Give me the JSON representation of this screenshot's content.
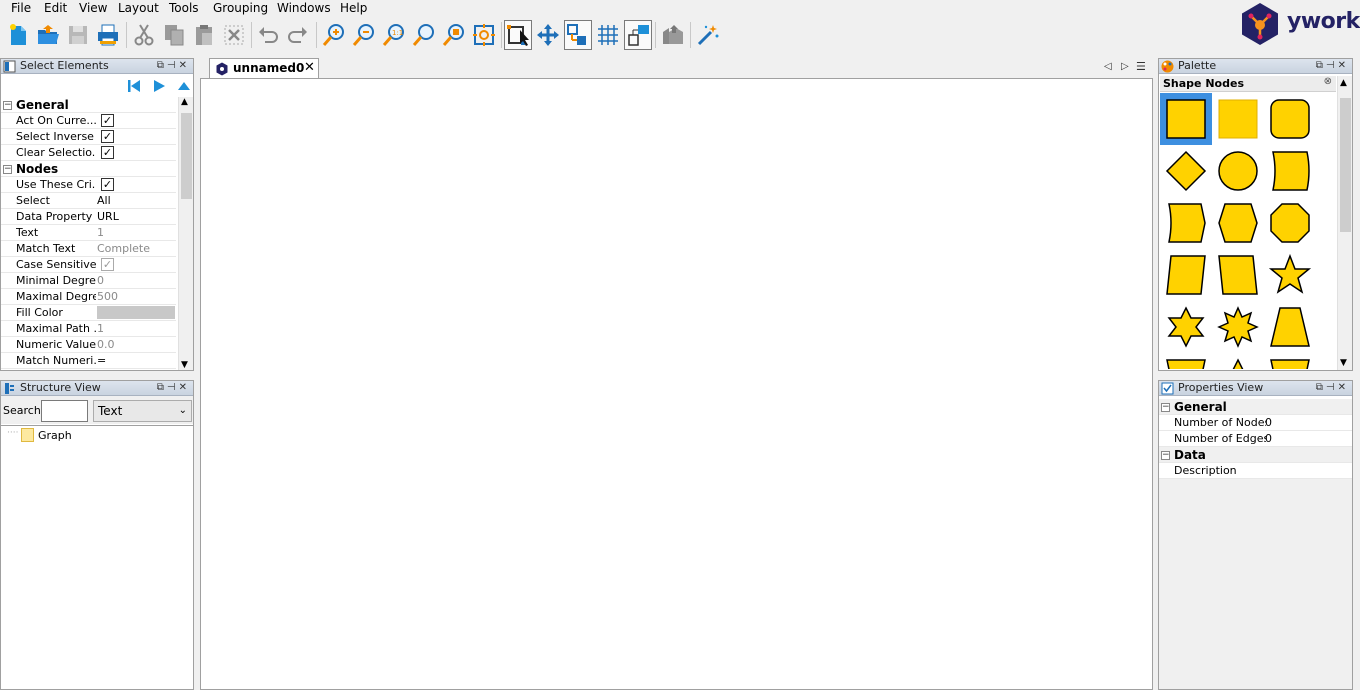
{
  "menu": [
    "File",
    "Edit",
    "View",
    "Layout",
    "Tools",
    "Grouping",
    "Windows",
    "Help"
  ],
  "logo": {
    "text": "yworks"
  },
  "toolbar": {
    "buttons": [
      "new-document",
      "open",
      "save",
      "print",
      "cut",
      "copy",
      "paste",
      "delete",
      "undo",
      "redo",
      "zoom-in",
      "zoom-out",
      "zoom-original",
      "zoom-fit",
      "zoom-area",
      "fit-content",
      "edit-mode",
      "move-mode",
      "port-mode",
      "grid",
      "snapping",
      "overview",
      "auto-layout"
    ]
  },
  "select_elements": {
    "title": "Select Elements",
    "general_section": "General",
    "nodes_section": "Nodes",
    "rows": [
      {
        "label": "Act On Curre...",
        "type": "checkbox",
        "checked": true
      },
      {
        "label": "Select Inverse",
        "type": "checkbox",
        "checked": true
      },
      {
        "label": "Clear Selectio...",
        "type": "checkbox",
        "checked": true
      },
      {
        "label": "Use These Cri...",
        "type": "checkbox",
        "checked": true
      },
      {
        "label": "Select",
        "value": "All"
      },
      {
        "label": "Data Property",
        "value": "URL"
      },
      {
        "label": "Text",
        "value": "1",
        "dim": true
      },
      {
        "label": "Match Text",
        "value": "Complete",
        "dim": true
      },
      {
        "label": "Case Sensitive",
        "type": "checkbox",
        "checked": true,
        "dim": true
      },
      {
        "label": "Minimal Degree",
        "value": "0",
        "dim": true
      },
      {
        "label": "Maximal Degree",
        "value": "500",
        "dim": true
      },
      {
        "label": "Fill Color",
        "value": "",
        "color": "#c8c8c8"
      },
      {
        "label": "Maximal Path ...",
        "value": "1",
        "dim": true
      },
      {
        "label": "Numeric Value",
        "value": "0.0",
        "dim": true
      },
      {
        "label": "Match Numeri...",
        "value": "="
      }
    ]
  },
  "structure_view": {
    "title": "Structure View",
    "search_label": "Search",
    "search_value": "",
    "combo_value": "Text",
    "tree": [
      {
        "label": "Graph"
      }
    ]
  },
  "editor": {
    "tab_label": "unnamed0"
  },
  "palette": {
    "title": "Palette",
    "section": "Shape Nodes",
    "fill_color": "#ffd200",
    "shapes": [
      "rectangle",
      "rectangle-plain",
      "rounded-rectangle",
      "diamond",
      "ellipse",
      "parallelogram-curved",
      "hexagon-curved",
      "hexagon",
      "octagon",
      "parallelogram",
      "trapezoid-right",
      "star5",
      "star6",
      "star8",
      "trapezoid"
    ]
  },
  "properties_view": {
    "title": "Properties View",
    "general_section": "General",
    "data_section": "Data",
    "general_rows": [
      {
        "label": "Number of Nodes",
        "value": "0"
      },
      {
        "label": "Number of Edges",
        "value": "0"
      }
    ],
    "data_rows": [
      {
        "label": "Description",
        "value": ""
      }
    ]
  }
}
